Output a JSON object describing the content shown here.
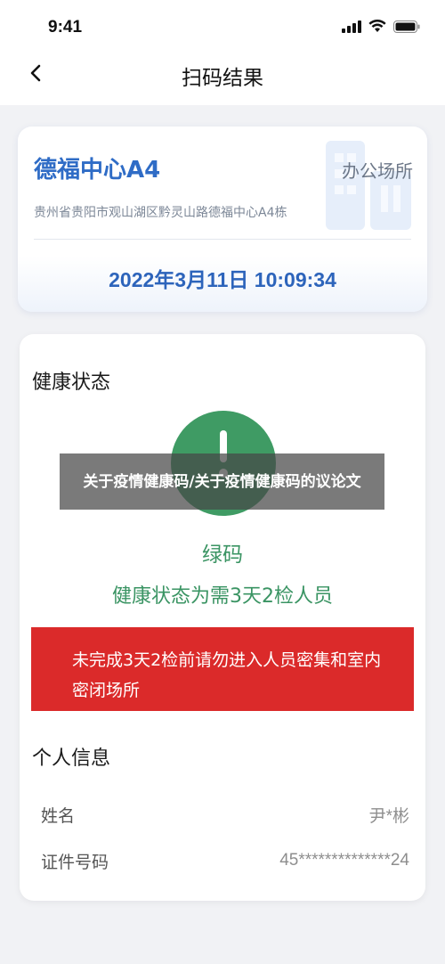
{
  "status_bar": {
    "time": "9:41"
  },
  "nav": {
    "title": "扫码结果",
    "back_icon": "chevron-left-icon"
  },
  "place": {
    "name": "德福中心A4",
    "type": "办公场所",
    "address": "贵州省贵阳市观山湖区黔灵山路德福中心A4栋",
    "datetime": "2022年3月11日 10:09:34",
    "bg_icon": "building-icon"
  },
  "health": {
    "section_title": "健康状态",
    "code_label": "绿码",
    "state_text": "健康状态为需3天2检人员",
    "warning_text": "未完成3天2检前请勿进入人员密集和室内密闭场所",
    "colors": {
      "green": "#3f9b64",
      "warning_red": "#db2a2a",
      "accent_blue": "#2f6cc6"
    }
  },
  "personal": {
    "section_title": "个人信息",
    "rows": [
      {
        "label": "姓名",
        "value": "尹*彬"
      },
      {
        "label": "证件号码",
        "value": "45**************24"
      }
    ]
  },
  "overlay": {
    "text": "关于疫情健康码/关于疫情健康码的议论文"
  }
}
